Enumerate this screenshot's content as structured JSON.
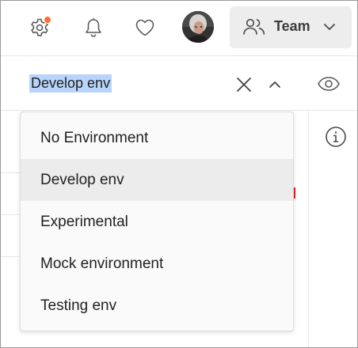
{
  "header": {
    "settings_icon": "gear-icon",
    "notification_dot_color": "#ff6c37",
    "notifications_icon": "bell-icon",
    "favorites_icon": "heart-icon",
    "avatar_icon": "user-avatar",
    "team": {
      "icon": "team-icon",
      "label": "Team",
      "chevron": "chevron-down-icon"
    }
  },
  "environment_search": {
    "value": "Develop env",
    "clear_icon": "close-icon",
    "collapse_icon": "chevron-up-icon",
    "view_icon": "eye-icon"
  },
  "info_icon": "info-icon",
  "dropdown": {
    "items": [
      {
        "label": "No Environment",
        "active": false
      },
      {
        "label": "Develop env",
        "active": true
      },
      {
        "label": "Experimental",
        "active": false
      },
      {
        "label": "Mock environment",
        "active": false
      },
      {
        "label": "Testing env",
        "active": false
      }
    ]
  },
  "colors": {
    "selection_highlight": "#b8d4fb",
    "accent": "#ff6c37",
    "active_item_bg": "#ececec"
  }
}
